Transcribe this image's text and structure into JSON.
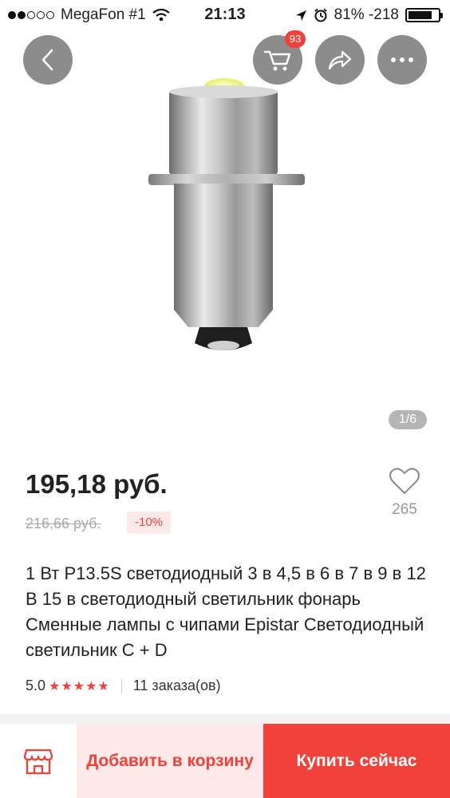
{
  "status_bar": {
    "carrier": "MegaFon #1",
    "time": "21:13",
    "battery": "81% -218",
    "battery_level": 0.81
  },
  "nav": {
    "back_icon": "chevron-left-icon",
    "cart_icon": "cart-icon",
    "cart_badge": "93",
    "share_icon": "share-icon",
    "more_icon": "more-dots-icon"
  },
  "gallery": {
    "counter": "1/6"
  },
  "product": {
    "price": "195,18 руб.",
    "old_price": "216,66 руб.",
    "discount": "-10%",
    "wishlist_count": "265",
    "title": "1 Вт P13.5S светодиодный 3 в 4,5 в 6 в 7 в 9 в 12 В 15 в светодиодный светильник фонарь Сменные лампы с чипами Epistar Светодиодный светильник C + D",
    "rating": "5.0",
    "stars": "★★★★★",
    "orders": "11 заказа(ов)"
  },
  "actions": {
    "add_to_cart": "Добавить в корзину",
    "buy_now": "Купить сейчас"
  },
  "colors": {
    "accent": "#f0413a",
    "accent_light": "#fde9e8"
  }
}
